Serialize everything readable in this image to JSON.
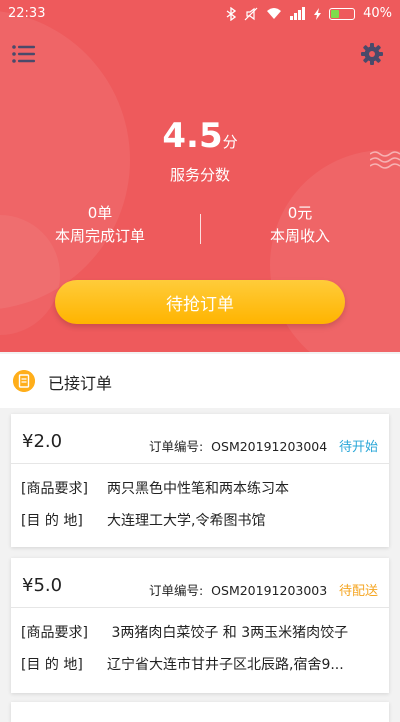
{
  "status_bar": {
    "time": "22:33",
    "battery": "40%",
    "battery_level": 0.4
  },
  "score": {
    "value": "4.5",
    "unit": "分",
    "label": "服务分数"
  },
  "stats": {
    "weekly_orders": {
      "value": "0单",
      "label": "本周完成订单"
    },
    "weekly_income": {
      "value": "0元",
      "label": "本周收入"
    }
  },
  "grab_button": {
    "label": "待抢订单"
  },
  "section": {
    "title": "已接订单"
  },
  "orders": [
    {
      "price": "¥2.0",
      "order_no_label": "订单编号:",
      "order_no": "OSM20191203004",
      "status": "待开始",
      "status_color": "#2aa7d8",
      "goods_label": "[商品要求]",
      "goods": "两只黑色中性笔和两本练习本",
      "dest_label": "[目  的  地]",
      "dest": "大连理工大学,令希图书馆"
    },
    {
      "price": "¥5.0",
      "order_no_label": "订单编号:",
      "order_no": "OSM20191203003",
      "status": "待配送",
      "status_color": "#f5a623",
      "goods_label": "[商品要求]",
      "goods": " 3两猪肉白菜饺子 和 3两玉米猪肉饺子",
      "dest_label": "[目  的  地]",
      "dest": "辽宁省大连市甘井子区北辰路,宿舍9..."
    }
  ],
  "colors": {
    "hero": "#ee5a5c",
    "button": "#ffbd1f",
    "accent": "#ffae1a"
  }
}
